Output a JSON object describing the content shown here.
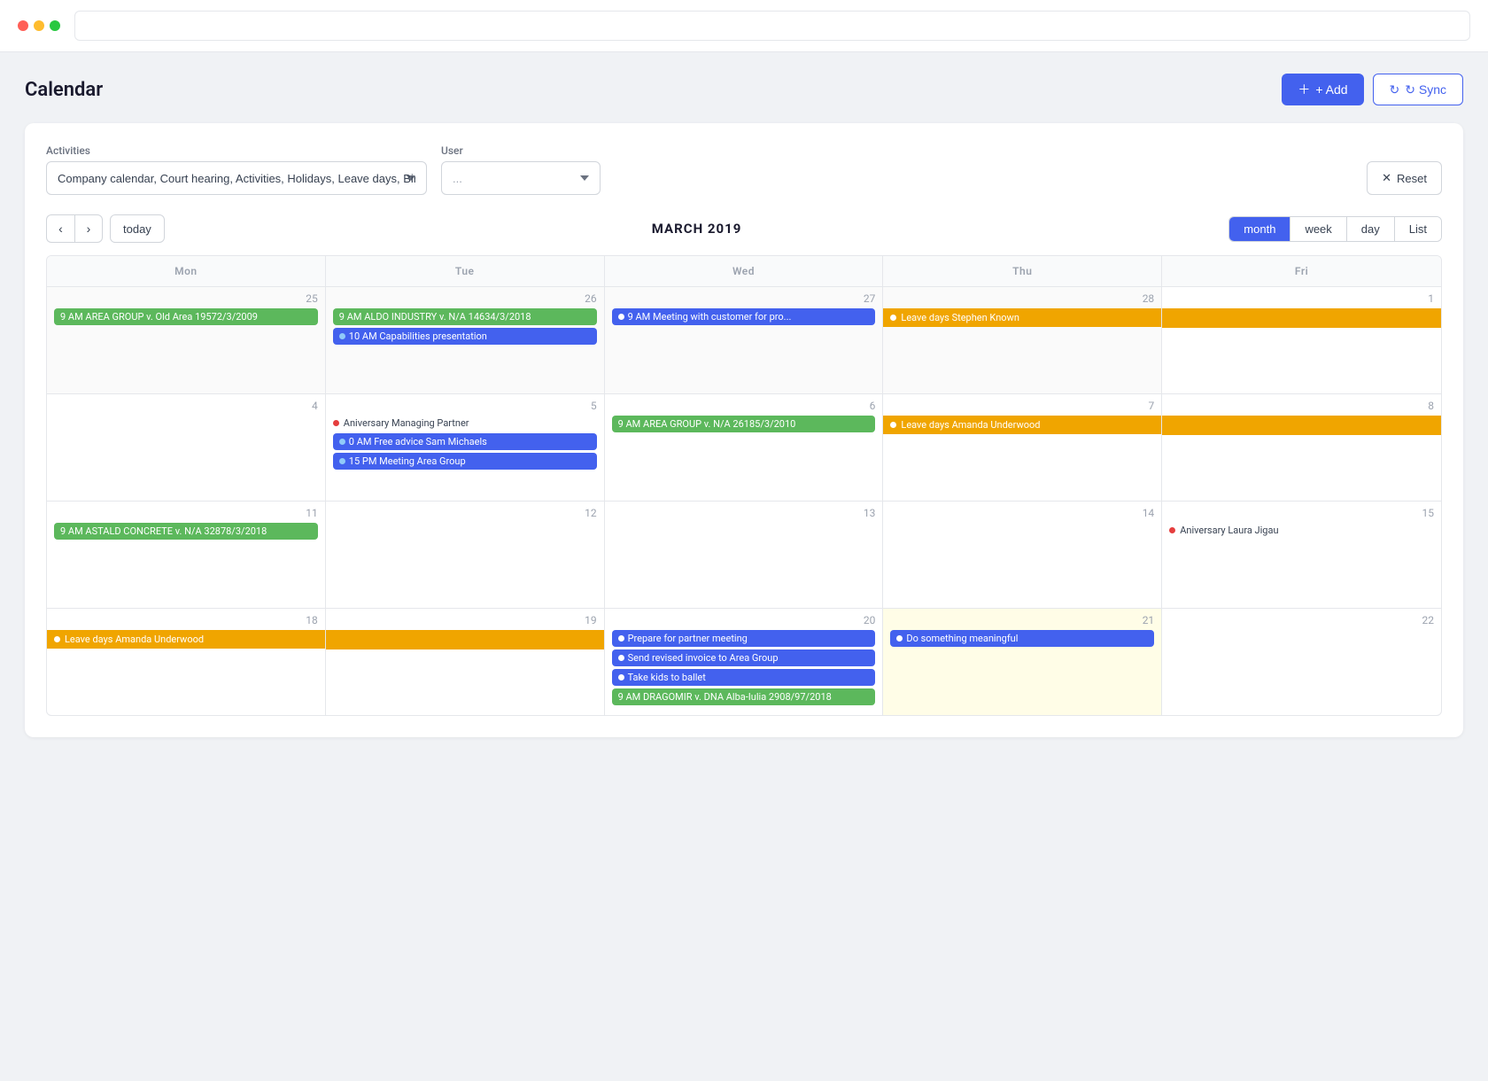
{
  "topbar": {
    "search_placeholder": ""
  },
  "header": {
    "title": "Calendar",
    "add_label": "+ Add",
    "sync_label": "↻ Sync"
  },
  "filters": {
    "activities_label": "Activities",
    "activities_value": "Company calendar, Court hearing, Activities, Holidays, Leave days, Birthdays",
    "user_label": "User",
    "user_placeholder": "...",
    "reset_label": "Reset"
  },
  "nav": {
    "prev_label": "<",
    "next_label": ">",
    "today_label": "today",
    "month_title": "MARCH 2019",
    "views": [
      "month",
      "week",
      "day",
      "List"
    ],
    "active_view": "month"
  },
  "days": [
    "Mon",
    "Tue",
    "Wed",
    "Thu",
    "Fri"
  ],
  "rows": [
    {
      "cells": [
        {
          "date": "25",
          "other": true,
          "events": [
            {
              "type": "green",
              "text": "9 AM AREA GROUP v. Old Area 19572/3/2009"
            }
          ]
        },
        {
          "date": "26",
          "other": true,
          "events": [
            {
              "type": "green",
              "text": "9 AM ALDO INDUSTRY v. N/A 14634/3/2018"
            },
            {
              "type": "blue",
              "text": "10 AM Capabilities presentation"
            }
          ]
        },
        {
          "date": "27",
          "other": true,
          "events": [
            {
              "type": "blue",
              "dot": "white",
              "text": "9 AM Meeting with customer for pro..."
            }
          ]
        },
        {
          "date": "28",
          "other": true,
          "events": [
            {
              "type": "orange",
              "dot": "white",
              "text": "Leave days Stephen Known",
              "span": true
            }
          ]
        },
        {
          "date": "1",
          "events": [
            {
              "type": "orange-span",
              "text": ""
            }
          ]
        }
      ]
    },
    {
      "cells": [
        {
          "date": "4",
          "events": []
        },
        {
          "date": "5",
          "events": [
            {
              "type": "outline-red",
              "text": "Aniversary Managing Partner"
            },
            {
              "type": "blue",
              "text": "0 AM Free advice Sam Michaels"
            },
            {
              "type": "blue",
              "text": "15 PM Meeting Area Group"
            }
          ]
        },
        {
          "date": "6",
          "events": [
            {
              "type": "green",
              "text": "9 AM AREA GROUP v. N/A 26185/3/2010"
            }
          ]
        },
        {
          "date": "7",
          "events": [
            {
              "type": "orange",
              "dot": "white",
              "text": "Leave days Amanda Underwood",
              "span": true
            }
          ]
        },
        {
          "date": "8",
          "events": [
            {
              "type": "orange-span",
              "text": ""
            }
          ]
        }
      ]
    },
    {
      "cells": [
        {
          "date": "11",
          "events": [
            {
              "type": "green",
              "text": "9 AM ASTALD CONCRETE v. N/A 32878/3/2018"
            }
          ]
        },
        {
          "date": "12",
          "events": []
        },
        {
          "date": "13",
          "events": []
        },
        {
          "date": "14",
          "events": []
        },
        {
          "date": "15",
          "events": [
            {
              "type": "outline-red",
              "text": "Aniversary Laura Jigau"
            }
          ]
        }
      ]
    },
    {
      "cells": [
        {
          "date": "18",
          "events": [
            {
              "type": "orange",
              "dot": "white",
              "text": "Leave days Amanda Underwood",
              "span": true
            }
          ]
        },
        {
          "date": "19",
          "events": [
            {
              "type": "orange-span-end",
              "text": ""
            }
          ]
        },
        {
          "date": "20",
          "events": [
            {
              "type": "blue",
              "dot": "white",
              "text": "Prepare for partner meeting"
            },
            {
              "type": "blue",
              "dot": "white",
              "text": "Send revised invoice to Area Group"
            },
            {
              "type": "blue",
              "dot": "white",
              "text": "Take kids to ballet"
            },
            {
              "type": "green",
              "text": "9 AM DRAGOMIR v. DNA Alba-Iulia 2908/97/2018"
            }
          ]
        },
        {
          "date": "21",
          "today": true,
          "events": [
            {
              "type": "blue",
              "dot": "white",
              "text": "Do something meaningful"
            }
          ]
        },
        {
          "date": "22",
          "events": []
        }
      ]
    }
  ]
}
